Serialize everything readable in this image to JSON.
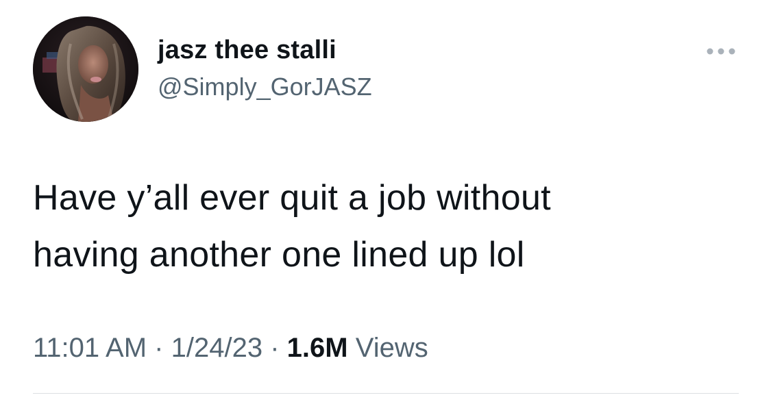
{
  "author": {
    "display_name": "jasz thee stalli",
    "handle": "@Simply_GorJASZ",
    "avatar_icon": "profile-photo"
  },
  "more_menu": {
    "icon": "more-horizontal-icon"
  },
  "tweet": {
    "line1": "Have y’all ever quit a job without",
    "line2": "having another one lined up lol"
  },
  "meta": {
    "time": "11:01 AM",
    "separator1": "·",
    "date": "1/24/23",
    "separator2": "·",
    "views_count": "1.6M",
    "views_label": "Views"
  },
  "colors": {
    "text_primary": "#0f1419",
    "text_secondary": "#536471",
    "divider": "#dcdfe3",
    "background": "#ffffff"
  }
}
